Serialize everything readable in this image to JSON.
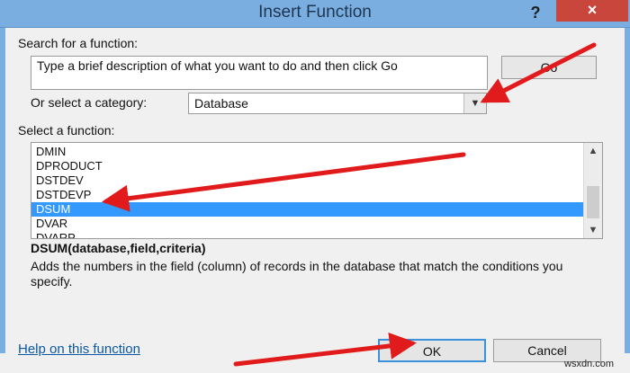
{
  "window": {
    "title": "Insert Function",
    "help_glyph": "?",
    "close_glyph": "×"
  },
  "search": {
    "label": "Search for a function:",
    "value": "Type a brief description of what you want to do and then click Go",
    "go_label": "Go"
  },
  "category": {
    "label": "Or select a category:",
    "value": "Database"
  },
  "functions": {
    "label": "Select a function:",
    "items": [
      "DMIN",
      "DPRODUCT",
      "DSTDEV",
      "DSTDEVP",
      "DSUM",
      "DVAR",
      "DVARP"
    ],
    "selected": "DSUM"
  },
  "details": {
    "syntax": "DSUM(database,field,criteria)",
    "description": "Adds the numbers in the field (column) of records in the database that match the conditions you specify."
  },
  "footer": {
    "help_link": "Help on this function",
    "ok_label": "OK",
    "cancel_label": "Cancel"
  },
  "watermark": "wsxdn.com",
  "colors": {
    "titlebar": "#7aaee0",
    "close_button": "#c9463d",
    "selection": "#3399ff",
    "annotation_arrow": "#e11b1b"
  }
}
